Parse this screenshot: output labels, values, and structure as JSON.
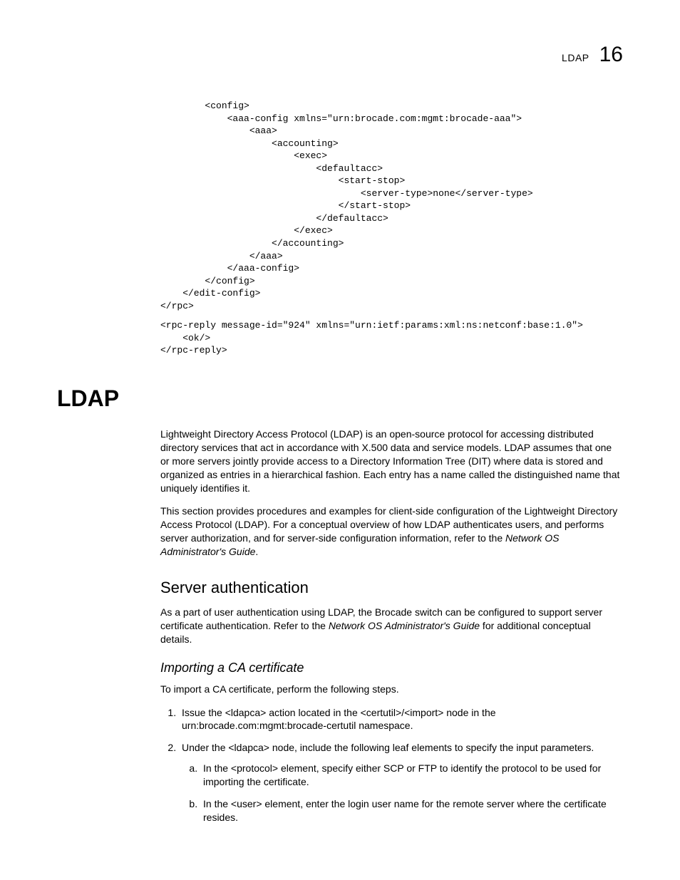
{
  "header": {
    "label": "LDAP",
    "chapter_number": "16"
  },
  "code": {
    "block1": "        <config>\n            <aaa-config xmlns=\"urn:brocade.com:mgmt:brocade-aaa\">\n                <aaa>\n                    <accounting>\n                        <exec>\n                            <defaultacc>\n                                <start-stop>\n                                    <server-type>none</server-type>\n                                </start-stop>\n                            </defaultacc>\n                        </exec>\n                    </accounting>\n                </aaa>\n            </aaa-config>\n        </config>\n    </edit-config>\n</rpc>",
    "block2": "<rpc-reply message-id=\"924\" xmlns=\"urn:ietf:params:xml:ns:netconf:base:1.0\">\n    <ok/>\n</rpc-reply>"
  },
  "section": {
    "title": "LDAP",
    "para1": "Lightweight Directory Access Protocol (LDAP) is an open-source protocol for accessing distributed directory services that act in accordance with X.500 data and service models. LDAP assumes that one or more servers jointly provide access to a Directory Information Tree (DIT) where data is stored and organized as entries in a hierarchical fashion. Each entry has a name called the distinguished name that uniquely identifies it.",
    "para2a": "This section provides procedures and examples for client-side configuration of the Lightweight Directory Access Protocol (LDAP). For a conceptual overview of how LDAP authenticates users, and performs server authorization, and for server-side configuration information, refer to the ",
    "para2b": "Network OS Administrator's Guide",
    "para2c": "."
  },
  "sub": {
    "title": "Server authentication",
    "para_a": "As a part of user authentication using LDAP, the Brocade switch can be configured to support server certificate authentication. Refer to the ",
    "para_b": "Network OS Administrator's Guide",
    "para_c": " for additional conceptual details."
  },
  "import": {
    "title": "Importing a CA certificate",
    "intro": "To import a CA certificate, perform the following steps.",
    "step1": "Issue the <ldapca> action located in the <certutil>/<import> node in the urn:brocade.com:mgmt:brocade-certutil namespace.",
    "step2": "Under the <ldapca> node, include the following leaf elements to specify the input parameters.",
    "step2a": "In the <protocol> element, specify either SCP or FTP to identify the protocol to be used for importing the certificate.",
    "step2b": "In the <user> element, enter the login user name for the remote server where the certificate resides."
  }
}
